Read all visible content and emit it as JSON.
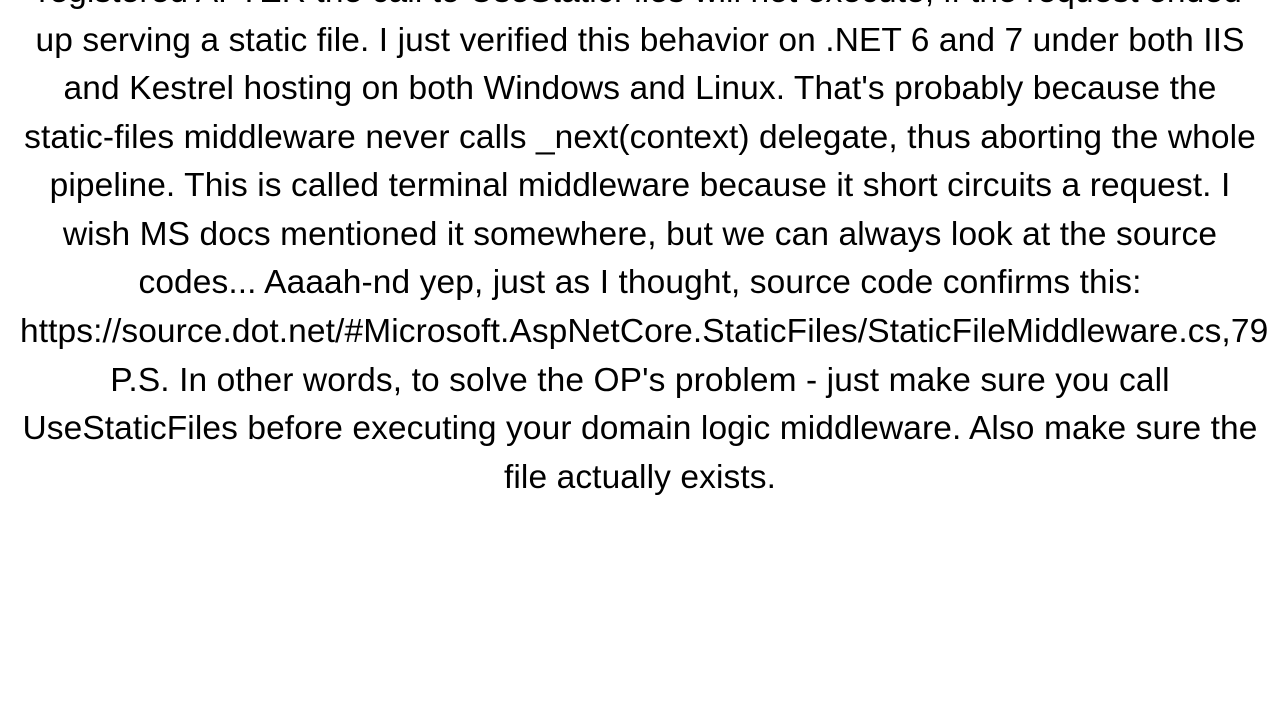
{
  "body": "registered AFTER the call to UseStaticFiles will not execute, if the request ended up serving a static file. I just verified this behavior on .NET 6 and 7 under both IIS and Kestrel hosting on both Windows and Linux. That's probably because the static-files middleware never calls _next(context) delegate, thus aborting the whole pipeline. This is called terminal middleware because it short circuits a request. I wish MS docs mentioned it somewhere, but we can always look at the source codes... Aaaah-nd yep, just as I thought, source code confirms this: https://source.dot.net/#Microsoft.AspNetCore.StaticFiles/StaticFileMiddleware.cs,79 P.S. In other words, to solve the OP's problem - just make sure you call UseStaticFiles before executing your domain logic middleware. Also make sure the file actually exists."
}
